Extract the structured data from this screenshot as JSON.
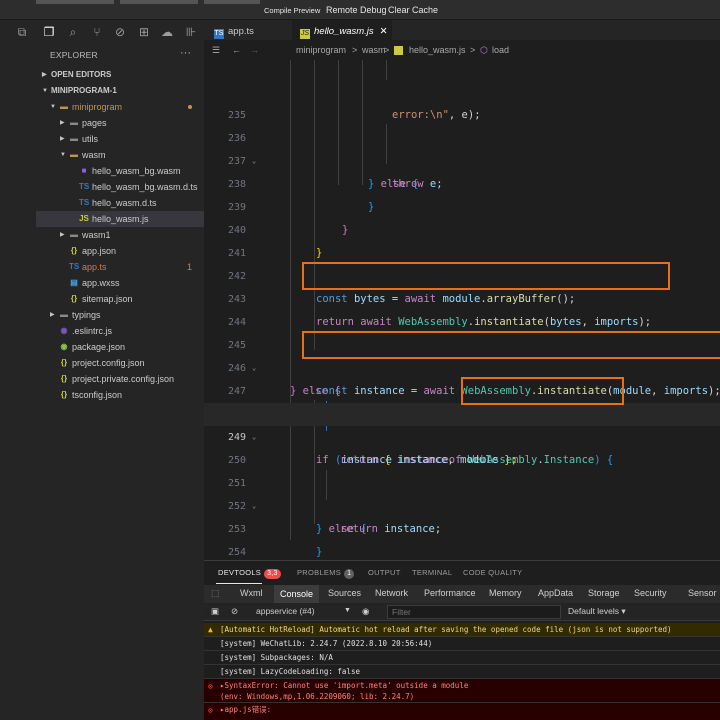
{
  "toolbar": {
    "compile_preview": "Compile Preview",
    "remote_debug": "Remote Debug",
    "clear_cache": "Clear Cache"
  },
  "activity_icons": [
    "files-icon",
    "search-icon",
    "source-control-icon",
    "debug-icon",
    "extensions-icon",
    "cloud-icon",
    "more-icon"
  ],
  "explorer": {
    "title": "EXPLORER",
    "more": "···",
    "sections": {
      "open_editors": "OPEN EDITORS",
      "project": "MINIPROGRAM-1"
    },
    "tree": [
      {
        "label": "miniprogram",
        "kind": "folder-open",
        "indent": 1,
        "color": "#c09553"
      },
      {
        "label": "pages",
        "kind": "folder",
        "indent": 2
      },
      {
        "label": "utils",
        "kind": "folder",
        "indent": 2
      },
      {
        "label": "wasm",
        "kind": "folder-open",
        "indent": 2
      },
      {
        "label": "hello_wasm_bg.wasm",
        "kind": "wasm",
        "indent": 3
      },
      {
        "label": "hello_wasm_bg.wasm.d.ts",
        "kind": "ts",
        "indent": 3
      },
      {
        "label": "hello_wasm.d.ts",
        "kind": "ts",
        "indent": 3
      },
      {
        "label": "hello_wasm.js",
        "kind": "js",
        "indent": 3
      },
      {
        "label": "wasm1",
        "kind": "folder",
        "indent": 2
      },
      {
        "label": "app.json",
        "kind": "json",
        "indent": 2
      },
      {
        "label": "app.ts",
        "kind": "ts",
        "indent": 2,
        "color": "#cf7c4d",
        "errors": "1"
      },
      {
        "label": "app.wxss",
        "kind": "wxss",
        "indent": 2
      },
      {
        "label": "sitemap.json",
        "kind": "json",
        "indent": 2
      },
      {
        "label": "typings",
        "kind": "folder",
        "indent": 1
      },
      {
        "label": ".eslintrc.js",
        "kind": "eslint",
        "indent": 1
      },
      {
        "label": "package.json",
        "kind": "npm",
        "indent": 1
      },
      {
        "label": "project.config.json",
        "kind": "json",
        "indent": 1
      },
      {
        "label": "project.private.config.json",
        "kind": "json",
        "indent": 1
      },
      {
        "label": "tsconfig.json",
        "kind": "json",
        "indent": 1
      }
    ]
  },
  "tabs": [
    {
      "label": "app.ts",
      "icon": "TS"
    },
    {
      "label": "hello_wasm.js",
      "icon": "JS",
      "close": "✕"
    }
  ],
  "breadcrumb": [
    "miniprogram",
    ">",
    "wasm",
    ">",
    "hello_wasm.js",
    ">",
    "load"
  ],
  "editor": {
    "line_numbers": [
      "",
      "235",
      "236",
      "237",
      "238",
      "239",
      "240",
      "241",
      "242",
      "243",
      "244",
      "245",
      "246",
      "247",
      "248",
      "249",
      "250",
      "251",
      "252",
      "253",
      "254",
      "255"
    ],
    "code": {
      "l0a": "error:\\n\"",
      "l0b": ", e);",
      "l2a": "} ",
      "l2b": "else",
      "l2c": " {",
      "l3a": "throw",
      "l3b": " e;",
      "l4": "}",
      "l5": "}",
      "l6": "}",
      "l8a": "const",
      "l8b": "bytes",
      "l8c": " = ",
      "l8d": "await",
      "l8e": "module",
      "l8f": ".",
      "l8g": "arrayBuffer",
      "l8h": "();",
      "l9a": "return",
      "l9b": "await",
      "l9c": "WebAssembly",
      "l9d": ".",
      "l9e": "instantiate",
      "l9f": "(",
      "l9g": "bytes",
      "l9h": ", ",
      "l9i": "imports",
      "l9j": ");",
      "l11a": "} ",
      "l11b": "else",
      "l11c": " {",
      "l12a": "const",
      "l12b": "instance",
      "l12c": " = ",
      "l12d": "await",
      "l12e": "WebAssembly",
      "l12f": ".",
      "l12g": "instantiate",
      "l12h": "(",
      "l12i": "module",
      "l12j": ", ",
      "l12k": "imports",
      "l12l": ");",
      "l14a": "if",
      "l14b": " (",
      "l14c": "instance",
      "l14d": "instanceof",
      "l14e": "WebAssembly",
      "l14f": ".",
      "l14g": "Instance",
      "l14h": ") {",
      "l15a": "return",
      "l15b": " { ",
      "l15c": "instance",
      "l15d": ", ",
      "l15e": "module",
      "l15f": " };",
      "l17a": "} ",
      "l17b": "else",
      "l17c": " {",
      "l18a": "return",
      "l18b": "instance",
      "l18c": ";",
      "l19": "}",
      "l20": "}",
      "l21": "}"
    }
  },
  "panel": {
    "tabs": {
      "devtools": "DEVTOOLS",
      "devtools_count": "3,3",
      "problems": "PROBLEMS",
      "problems_count": "1",
      "output": "OUTPUT",
      "terminal": "TERMINAL",
      "code_quality": "CODE QUALITY"
    },
    "devtools_tabs": [
      "Wxml",
      "Console",
      "Sources",
      "Network",
      "Performance",
      "Memory",
      "AppData",
      "Storage",
      "Security",
      "Sensor"
    ],
    "context": "appservice (#4)",
    "filter_placeholder": "Filter",
    "levels": "Default levels ▾",
    "console": {
      "warn": "[Automatic HotReload] Automatic hot reload after saving the opened code file (json is not supported)",
      "sys1": "[system] WeChatLib: 2.24.7 (2022.8.10 20:56:44)",
      "sys2": "[system] Subpackages: N/A",
      "sys3": "[system] LazyCodeLoading: false",
      "err1a": "▸SyntaxError: Cannot use 'import.meta' outside a module",
      "err1b": "(env: Windows,mp,1.06.2209060; lib: 2.24.7)",
      "err2": "▸app.js错误:"
    }
  },
  "colors": {
    "accent": "#e8701a",
    "error_badge": "#f14c4c",
    "folder": "#c09553"
  }
}
